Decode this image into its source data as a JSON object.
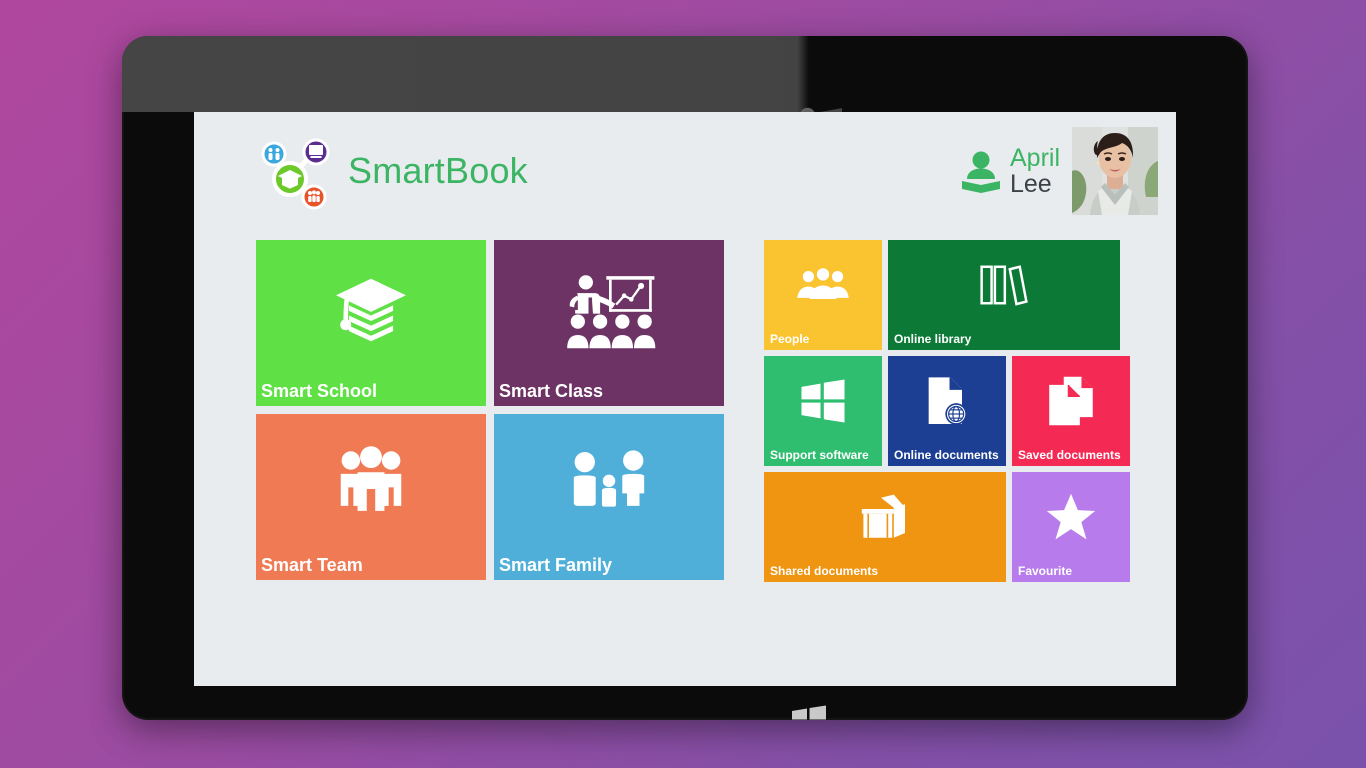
{
  "app": {
    "brand_name": "SmartBook",
    "brand_color": "#3bb563",
    "screen_bg": "#e9ecef",
    "wallpaper_gradient": [
      "#b0479f",
      "#7a52ab"
    ]
  },
  "profile": {
    "first_name": "April",
    "last_name": "Lee",
    "first_name_color": "#3bb563",
    "last_name_color": "#3d4246",
    "icon": "user-book-icon",
    "avatar": "user-photo"
  },
  "device": {
    "frame_color": "#0b0b0b",
    "bezel_sheen_color": "#454545",
    "home_button_icon": "windows-logo-icon",
    "camera": "front-camera"
  },
  "main_tiles": [
    {
      "id": "t-school",
      "label": "Smart School",
      "color": "#5fe045",
      "icon": "graduation-cap-icon"
    },
    {
      "id": "t-class",
      "label": "Smart Class",
      "color": "#6d3364",
      "icon": "teacher-classroom-icon"
    },
    {
      "id": "t-team",
      "label": "Smart Team",
      "color": "#ef7a54",
      "icon": "three-people-icon"
    },
    {
      "id": "t-family",
      "label": "Smart Family",
      "color": "#4fafd8",
      "icon": "family-icon"
    }
  ],
  "side_tiles": [
    {
      "id": "t-people",
      "label": "People",
      "color": "#fac430",
      "icon": "people-group-icon"
    },
    {
      "id": "t-library",
      "label": "Online library",
      "color": "#0c7a36",
      "icon": "books-icon"
    },
    {
      "id": "t-support",
      "label": "Support software",
      "color": "#2fbd6f",
      "icon": "windows-logo-icon"
    },
    {
      "id": "t-onlinedoc",
      "label": "Online documents",
      "color": "#1c3f94",
      "icon": "document-globe-icon"
    },
    {
      "id": "t-saveddoc",
      "label": "Saved documents",
      "color": "#f42a55",
      "icon": "document-stack-icon"
    },
    {
      "id": "t-shared",
      "label": "Shared documents",
      "color": "#ef9512",
      "icon": "open-box-icon"
    },
    {
      "id": "t-fav",
      "label": "Favourite",
      "color": "#b77bec",
      "icon": "star-icon"
    }
  ]
}
